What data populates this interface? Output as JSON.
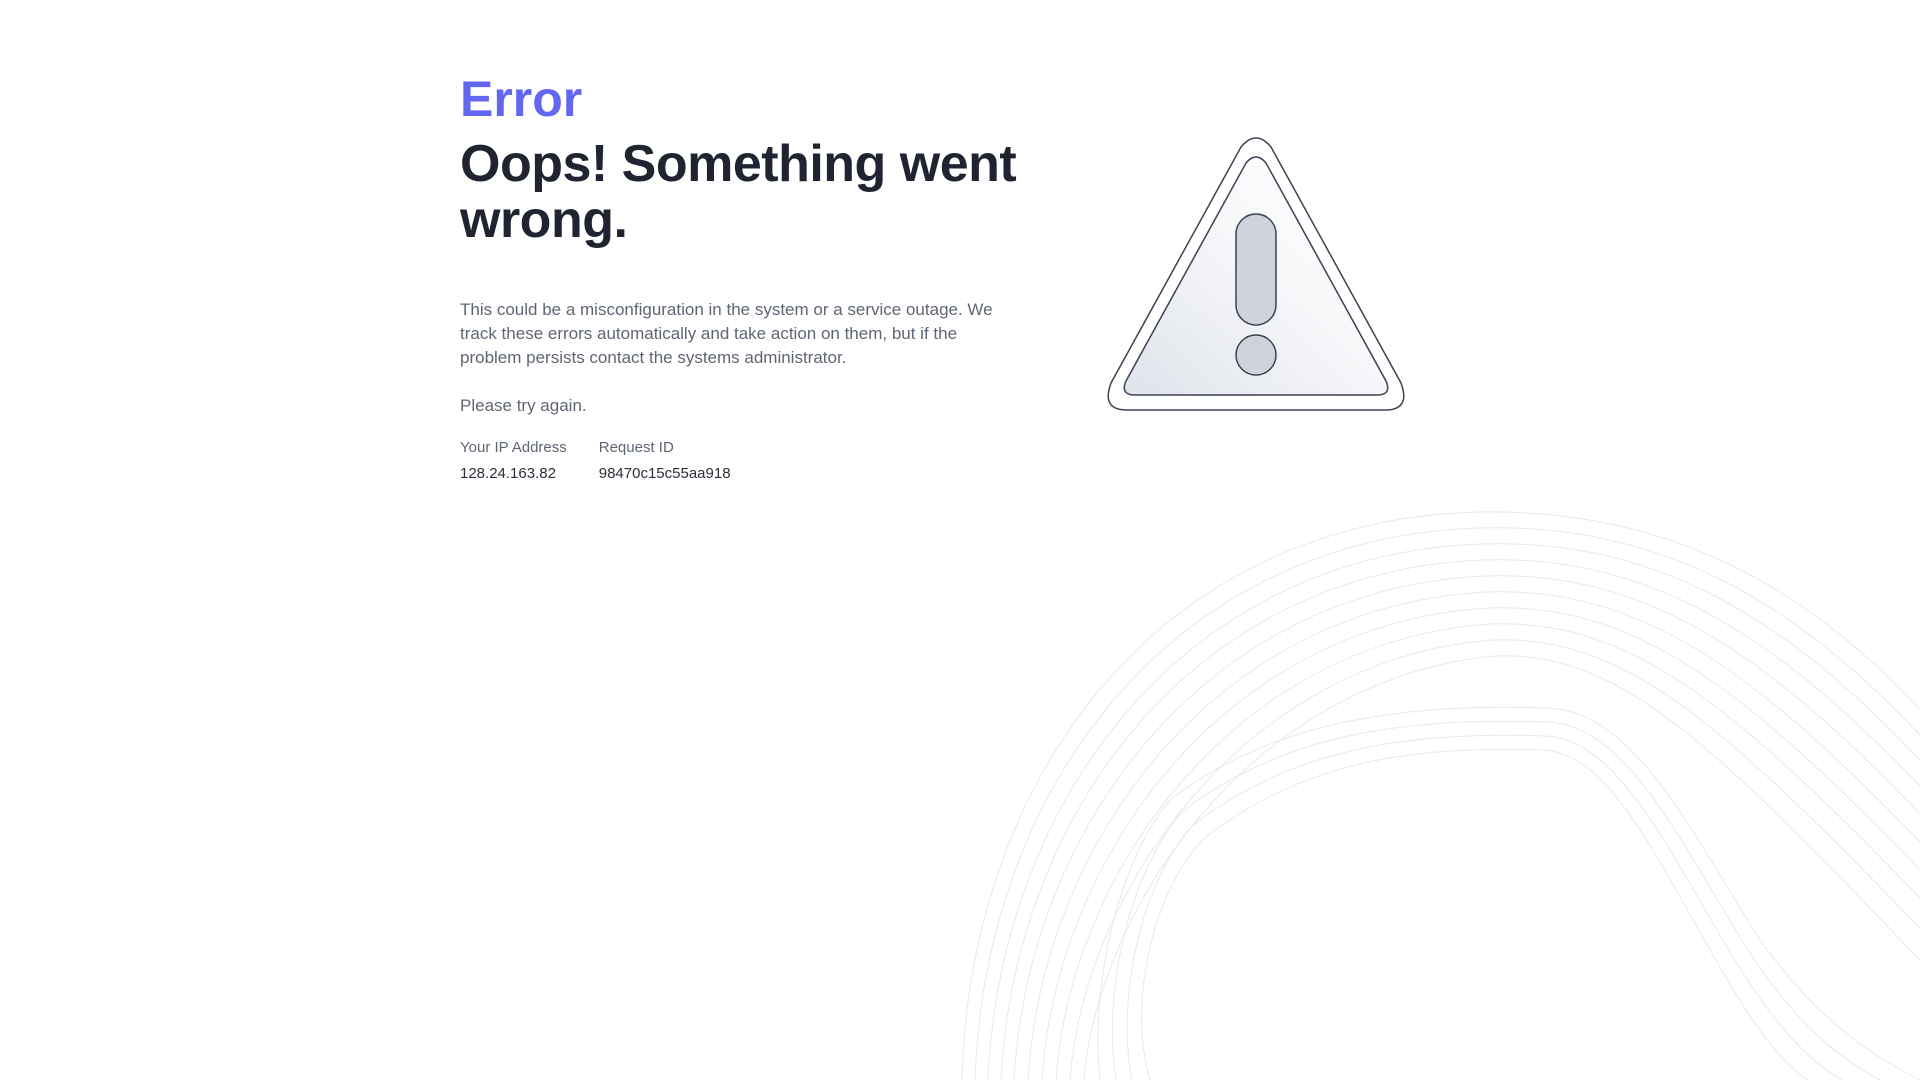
{
  "error_page": {
    "eyebrow": "Error",
    "headline": "Oops! Something went wrong.",
    "description": "This could be a misconfiguration in the system or a service outage. We track these errors automatically and take action on them, but if the problem persists contact the systems administrator.",
    "retry_text": "Please try again.",
    "details": {
      "ip_label": "Your IP Address",
      "ip_value": "128.24.163.82",
      "request_label": "Request ID",
      "request_value": "98470c15c55aa918"
    }
  },
  "icons": {
    "warning": "warning-triangle-icon"
  },
  "colors": {
    "accent": "#6366f1",
    "heading": "#1f2430",
    "body_text": "#5f6673",
    "icon_fill": "#cfd4dc",
    "icon_stroke": "#3c4150"
  }
}
